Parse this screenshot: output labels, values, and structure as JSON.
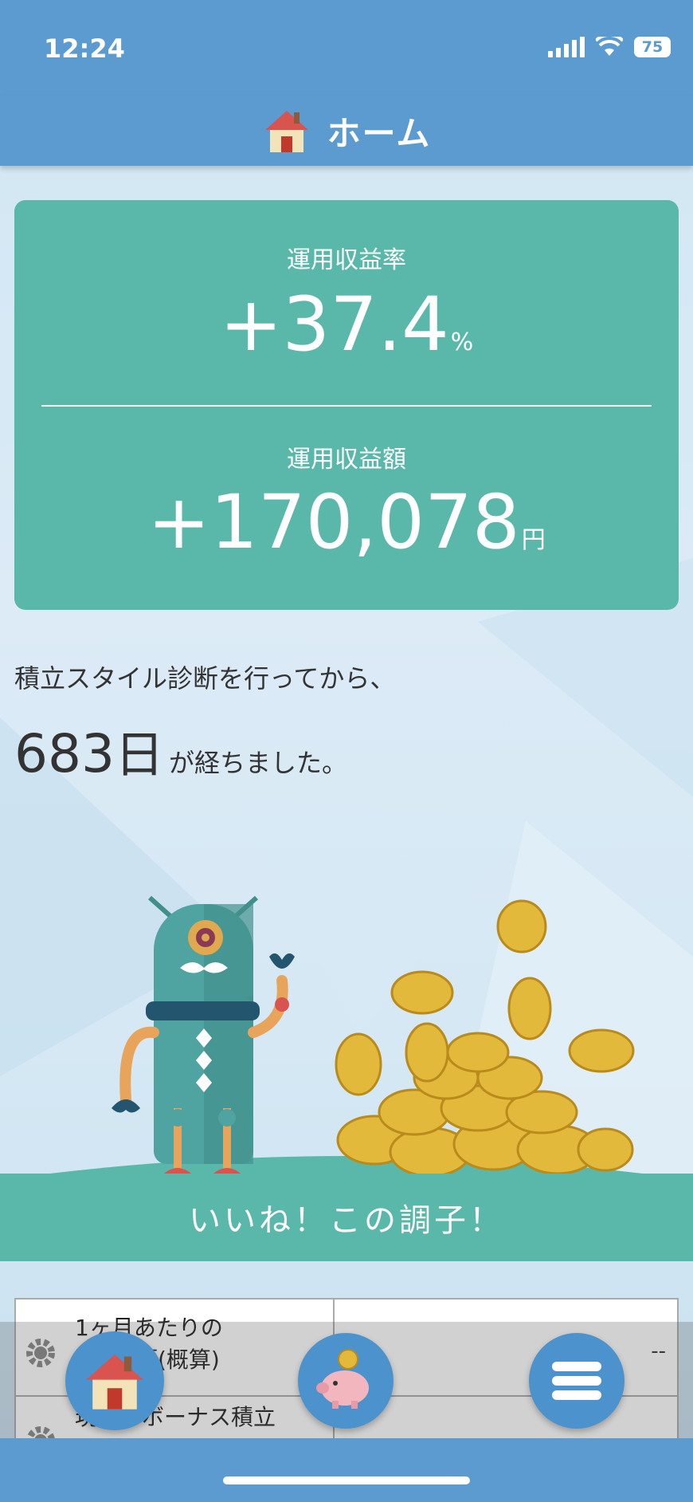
{
  "status": {
    "time": "12:24",
    "battery": "75"
  },
  "header": {
    "title": "ホーム",
    "icon": "house-icon"
  },
  "summary": {
    "rate_label": "運用収益率",
    "rate_value": "+37.4",
    "rate_unit": "%",
    "amount_label": "運用収益額",
    "amount_value": "+170,078",
    "amount_unit": "円"
  },
  "diagnosis": {
    "intro": "積立スタイル診断を行ってから、",
    "days": "683",
    "days_unit": "日",
    "suffix": "が経ちました。"
  },
  "banner": {
    "message": "いいね！この調子！"
  },
  "table": {
    "rows": [
      {
        "label_line1": "1ヶ月あたりの",
        "label_line2": "額(概算)",
        "value": "--"
      },
      {
        "label_line1": "現在のボーナス積立",
        "value": ""
      }
    ]
  },
  "nav": {
    "items": [
      "house-icon",
      "piggy-bank-icon",
      "menu-icon"
    ]
  },
  "colors": {
    "primary": "#5b9bd0",
    "accent": "#5ab8ab",
    "fab": "#4c92cc"
  }
}
